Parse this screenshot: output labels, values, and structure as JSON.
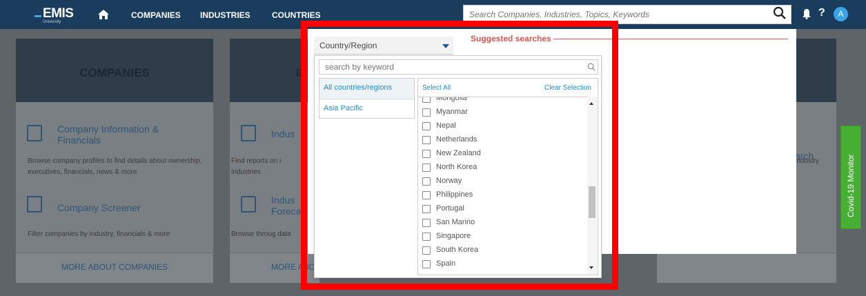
{
  "header": {
    "logo_text": "EMIS",
    "logo_sub": "University",
    "nav": [
      "COMPANIES",
      "INDUSTRIES",
      "COUNTRIES"
    ],
    "search_placeholder": "Search Companies, Industries, Topics, Keywords",
    "help": "?",
    "avatar": "A"
  },
  "cards": {
    "companies": {
      "title": "COMPANIES",
      "item1_title": "Company Information & Financials",
      "item1_text": "Browse company profiles to find details about ownership, executives, financials, news & more",
      "item2_title": "Company Screener",
      "item2_text": "Filter companies by industry, financials & more",
      "footer": "MORE ABOUT COMPANIES"
    },
    "industries": {
      "title_partial": "IND",
      "item1_title": "Indus",
      "item1_text": "Find reports on i industries",
      "item2_title": "Indus Foreca",
      "item2_text": "Browse throug data",
      "footer": "MORE ABO"
    },
    "right": {
      "item1_title": "arch",
      "item1_text": "industry"
    }
  },
  "covid_tab": "Covid-19 Monitor",
  "suggested": {
    "title": "Suggested searches"
  },
  "country_filter": {
    "select_label": "Country/Region",
    "keyword_placeholder": "search by keyword",
    "regions": [
      "All countries/regions",
      "Asia Pacific"
    ],
    "select_all": "Select All",
    "clear_selection": "Clear Selection",
    "countries": [
      "Mongolia",
      "Myanmar",
      "Nepal",
      "Netherlands",
      "New Zealand",
      "North Korea",
      "Norway",
      "Philippines",
      "Portugal",
      "San Marino",
      "Singapore",
      "South Korea",
      "Spain"
    ]
  },
  "colors": {
    "nav_bg": "#1a3d5e",
    "link": "#1a8fc7",
    "highlight": "#ff0000",
    "covid": "#47b034",
    "suggest": "#d9534f"
  }
}
